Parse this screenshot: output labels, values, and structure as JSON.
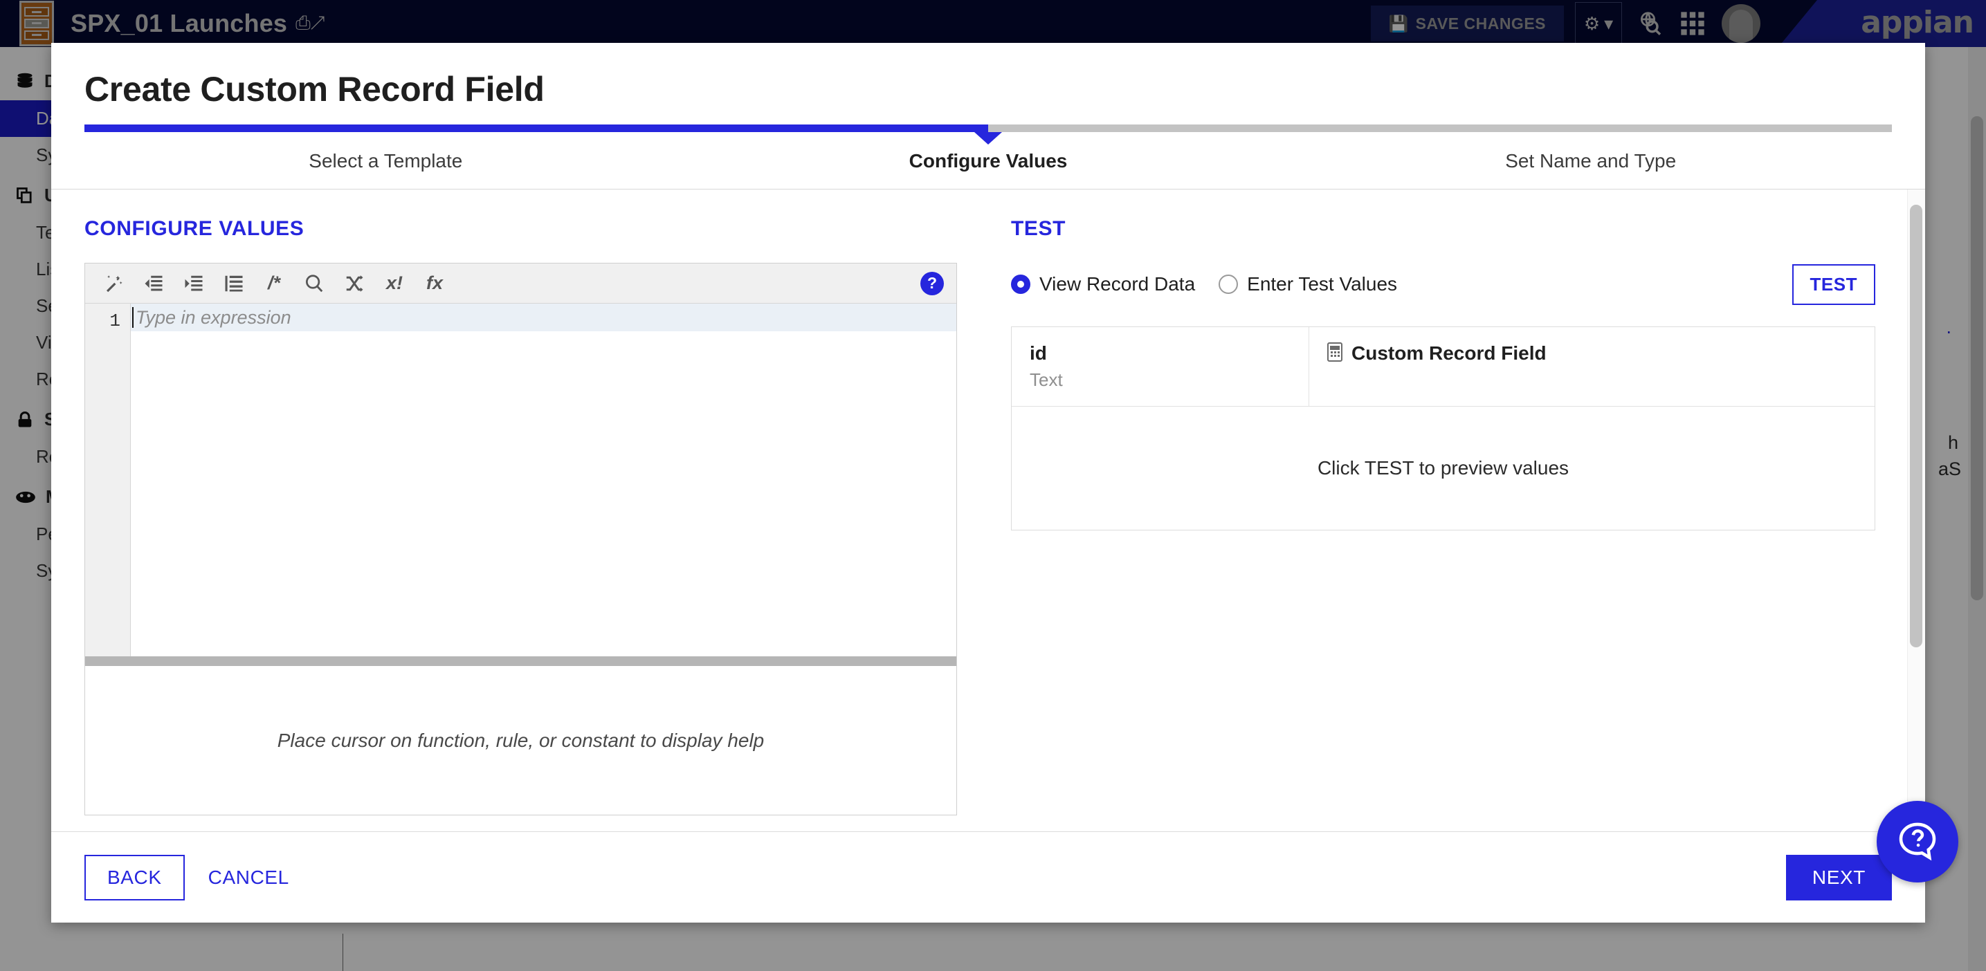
{
  "colors": {
    "accent": "#2626dd",
    "header_bg": "#050a32",
    "logo_bg": "#1c219a",
    "app_icon": "#b4651c"
  },
  "topbar": {
    "app_title": "SPX_01 Launches",
    "title_external_icon": "external-link-icon",
    "app_icon_name": "record-type-cabinet-icon",
    "save_changes_label": "SAVE CHANGES",
    "save_icon": "floppy-disk-icon",
    "gear_icon": "gear-icon",
    "gear_caret": "▾",
    "search_icon": "globe-search-icon",
    "apps_icon": "grid-apps-icon",
    "avatar_icon": "user-avatar",
    "brand_logo": "appian"
  },
  "sidebar": {
    "groups": [
      {
        "label": "D",
        "icon": "database-icon",
        "items": [
          {
            "label": "Da",
            "active": true
          },
          {
            "label": "Sy",
            "active": false
          }
        ]
      },
      {
        "label": "U",
        "icon": "interface-copy-icon",
        "items": [
          {
            "label": "Te",
            "active": false
          },
          {
            "label": "Lis",
            "active": false
          },
          {
            "label": "Se",
            "active": false
          },
          {
            "label": "Vi",
            "active": false
          },
          {
            "label": "Re",
            "active": false
          }
        ]
      },
      {
        "label": "S",
        "icon": "lock-icon",
        "items": [
          {
            "label": "Re",
            "active": false
          }
        ]
      },
      {
        "label": "M",
        "icon": "gauge-icon",
        "items": [
          {
            "label": "Pe",
            "active": false
          },
          {
            "label": "Sy",
            "active": false
          }
        ]
      }
    ]
  },
  "background_content": {
    "fragment_1": "h",
    "fragment_2": "aS",
    "fragment_3": "."
  },
  "modal": {
    "title": "Create Custom Record Field",
    "stepper": {
      "progress_percent": 50,
      "steps": [
        {
          "label": "Select a Template",
          "current": false
        },
        {
          "label": "Configure Values",
          "current": true
        },
        {
          "label": "Set Name and Type",
          "current": false
        }
      ]
    },
    "left_pane": {
      "heading": "CONFIGURE VALUES",
      "toolbar_icons": [
        {
          "name": "magic-wand-icon",
          "glyph": "✨"
        },
        {
          "name": "outdent-icon",
          "glyph": "⇤"
        },
        {
          "name": "indent-icon",
          "glyph": "⇥"
        },
        {
          "name": "format-list-icon",
          "glyph": "☰"
        },
        {
          "name": "comment-icon",
          "glyph": "/*"
        },
        {
          "name": "search-icon",
          "glyph": "🔍"
        },
        {
          "name": "shuffle-icon",
          "glyph": "⤬"
        },
        {
          "name": "variables-icon",
          "glyph": "x!"
        },
        {
          "name": "functions-icon",
          "glyph": "fx"
        }
      ],
      "help_badge": "?",
      "line_number": "1",
      "editor_placeholder": "Type in expression",
      "editor_value": "",
      "help_panel_text": "Place cursor on function, rule, or constant to display help"
    },
    "right_pane": {
      "heading": "TEST",
      "radios": [
        {
          "label": "View Record Data",
          "selected": true
        },
        {
          "label": "Enter Test Values",
          "selected": false
        }
      ],
      "test_button_label": "TEST",
      "table": {
        "columns": [
          {
            "name": "id",
            "type": "Text",
            "icon": ""
          },
          {
            "name": "Custom Record Field",
            "type": "",
            "icon": "calculator-icon"
          }
        ],
        "empty_message": "Click TEST to preview values"
      }
    },
    "footer": {
      "back_label": "BACK",
      "cancel_label": "CANCEL",
      "next_label": "NEXT"
    }
  },
  "help_fab": {
    "icon": "question-chat-icon"
  }
}
